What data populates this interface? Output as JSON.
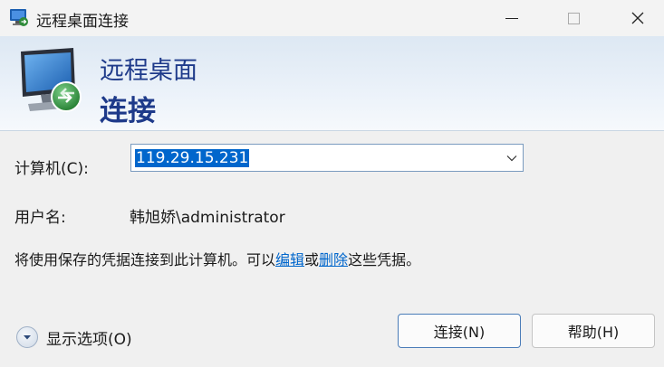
{
  "window": {
    "title": "远程桌面连接",
    "minimize_icon": "minimize-icon",
    "maximize_icon": "maximize-icon",
    "close_icon": "close-icon"
  },
  "banner": {
    "line1": "远程桌面",
    "line2": "连接",
    "icon": "remote-desktop-monitor-icon",
    "title_color": "#1e3a8a"
  },
  "form": {
    "computer_label": "计算机(C):",
    "computer_value": "119.29.15.231",
    "user_label": "用户名:",
    "user_value": "韩旭娇\\administrator"
  },
  "note": {
    "prefix": "将使用保存的凭据连接到此计算机。可以",
    "edit_link": "编辑",
    "middle": "或",
    "delete_link": "删除",
    "suffix": "这些凭据。",
    "link_color": "#0066cc"
  },
  "footer": {
    "options_label": "显示选项(O)",
    "connect_button": "连接(N)",
    "help_button": "帮助(H)"
  }
}
